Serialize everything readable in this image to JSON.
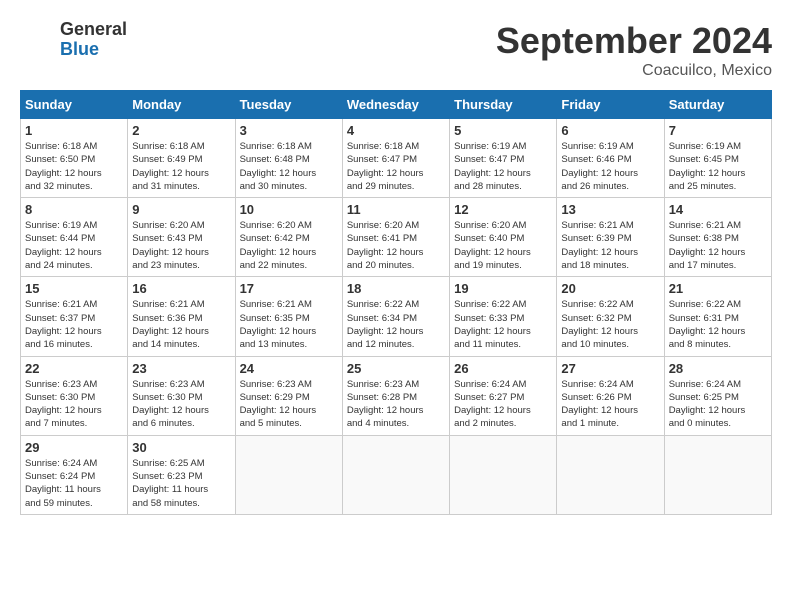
{
  "logo": {
    "line1": "General",
    "line2": "Blue"
  },
  "title": "September 2024",
  "location": "Coacuilco, Mexico",
  "weekdays": [
    "Sunday",
    "Monday",
    "Tuesday",
    "Wednesday",
    "Thursday",
    "Friday",
    "Saturday"
  ],
  "weeks": [
    [
      {
        "day": "1",
        "info": "Sunrise: 6:18 AM\nSunset: 6:50 PM\nDaylight: 12 hours\nand 32 minutes."
      },
      {
        "day": "2",
        "info": "Sunrise: 6:18 AM\nSunset: 6:49 PM\nDaylight: 12 hours\nand 31 minutes."
      },
      {
        "day": "3",
        "info": "Sunrise: 6:18 AM\nSunset: 6:48 PM\nDaylight: 12 hours\nand 30 minutes."
      },
      {
        "day": "4",
        "info": "Sunrise: 6:18 AM\nSunset: 6:47 PM\nDaylight: 12 hours\nand 29 minutes."
      },
      {
        "day": "5",
        "info": "Sunrise: 6:19 AM\nSunset: 6:47 PM\nDaylight: 12 hours\nand 28 minutes."
      },
      {
        "day": "6",
        "info": "Sunrise: 6:19 AM\nSunset: 6:46 PM\nDaylight: 12 hours\nand 26 minutes."
      },
      {
        "day": "7",
        "info": "Sunrise: 6:19 AM\nSunset: 6:45 PM\nDaylight: 12 hours\nand 25 minutes."
      }
    ],
    [
      {
        "day": "8",
        "info": "Sunrise: 6:19 AM\nSunset: 6:44 PM\nDaylight: 12 hours\nand 24 minutes."
      },
      {
        "day": "9",
        "info": "Sunrise: 6:20 AM\nSunset: 6:43 PM\nDaylight: 12 hours\nand 23 minutes."
      },
      {
        "day": "10",
        "info": "Sunrise: 6:20 AM\nSunset: 6:42 PM\nDaylight: 12 hours\nand 22 minutes."
      },
      {
        "day": "11",
        "info": "Sunrise: 6:20 AM\nSunset: 6:41 PM\nDaylight: 12 hours\nand 20 minutes."
      },
      {
        "day": "12",
        "info": "Sunrise: 6:20 AM\nSunset: 6:40 PM\nDaylight: 12 hours\nand 19 minutes."
      },
      {
        "day": "13",
        "info": "Sunrise: 6:21 AM\nSunset: 6:39 PM\nDaylight: 12 hours\nand 18 minutes."
      },
      {
        "day": "14",
        "info": "Sunrise: 6:21 AM\nSunset: 6:38 PM\nDaylight: 12 hours\nand 17 minutes."
      }
    ],
    [
      {
        "day": "15",
        "info": "Sunrise: 6:21 AM\nSunset: 6:37 PM\nDaylight: 12 hours\nand 16 minutes."
      },
      {
        "day": "16",
        "info": "Sunrise: 6:21 AM\nSunset: 6:36 PM\nDaylight: 12 hours\nand 14 minutes."
      },
      {
        "day": "17",
        "info": "Sunrise: 6:21 AM\nSunset: 6:35 PM\nDaylight: 12 hours\nand 13 minutes."
      },
      {
        "day": "18",
        "info": "Sunrise: 6:22 AM\nSunset: 6:34 PM\nDaylight: 12 hours\nand 12 minutes."
      },
      {
        "day": "19",
        "info": "Sunrise: 6:22 AM\nSunset: 6:33 PM\nDaylight: 12 hours\nand 11 minutes."
      },
      {
        "day": "20",
        "info": "Sunrise: 6:22 AM\nSunset: 6:32 PM\nDaylight: 12 hours\nand 10 minutes."
      },
      {
        "day": "21",
        "info": "Sunrise: 6:22 AM\nSunset: 6:31 PM\nDaylight: 12 hours\nand 8 minutes."
      }
    ],
    [
      {
        "day": "22",
        "info": "Sunrise: 6:23 AM\nSunset: 6:30 PM\nDaylight: 12 hours\nand 7 minutes."
      },
      {
        "day": "23",
        "info": "Sunrise: 6:23 AM\nSunset: 6:30 PM\nDaylight: 12 hours\nand 6 minutes."
      },
      {
        "day": "24",
        "info": "Sunrise: 6:23 AM\nSunset: 6:29 PM\nDaylight: 12 hours\nand 5 minutes."
      },
      {
        "day": "25",
        "info": "Sunrise: 6:23 AM\nSunset: 6:28 PM\nDaylight: 12 hours\nand 4 minutes."
      },
      {
        "day": "26",
        "info": "Sunrise: 6:24 AM\nSunset: 6:27 PM\nDaylight: 12 hours\nand 2 minutes."
      },
      {
        "day": "27",
        "info": "Sunrise: 6:24 AM\nSunset: 6:26 PM\nDaylight: 12 hours\nand 1 minute."
      },
      {
        "day": "28",
        "info": "Sunrise: 6:24 AM\nSunset: 6:25 PM\nDaylight: 12 hours\nand 0 minutes."
      }
    ],
    [
      {
        "day": "29",
        "info": "Sunrise: 6:24 AM\nSunset: 6:24 PM\nDaylight: 11 hours\nand 59 minutes."
      },
      {
        "day": "30",
        "info": "Sunrise: 6:25 AM\nSunset: 6:23 PM\nDaylight: 11 hours\nand 58 minutes."
      },
      {
        "day": "",
        "info": ""
      },
      {
        "day": "",
        "info": ""
      },
      {
        "day": "",
        "info": ""
      },
      {
        "day": "",
        "info": ""
      },
      {
        "day": "",
        "info": ""
      }
    ]
  ]
}
